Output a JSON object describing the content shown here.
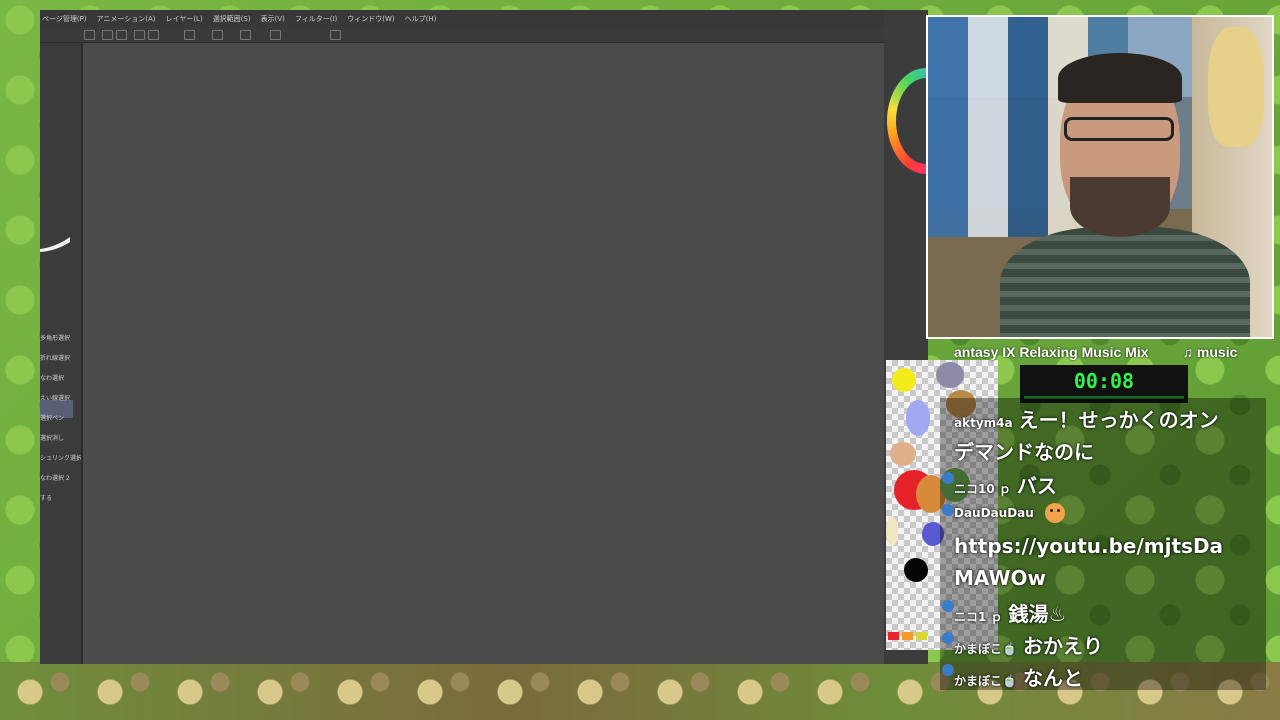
{
  "app": {
    "menu": [
      "ページ管理(P)",
      "アニメーション(A)",
      "レイヤー(L)",
      "選択範囲(S)",
      "表示(V)",
      "フィルター(I)",
      "ウィンドウ(W)",
      "ヘルプ(H)"
    ],
    "left_panel_items": [
      "多角形選択",
      "折れ線選択",
      "なわ選択",
      "えい線選択",
      "選択ペン",
      "選択消し",
      "シュリンク選択",
      "なわ選択 2",
      "する"
    ]
  },
  "stream": {
    "ticker": "antasy IX Relaxing Music Mix",
    "ticker_suffix": "♫ music",
    "timer": "00:08"
  },
  "chat": {
    "messages": [
      {
        "user": "aktym4a",
        "text": "えー！せっかくのオン"
      },
      {
        "user": "",
        "text": "デマンドなのに"
      },
      {
        "user": "ニコ10 ｐ",
        "text": "バス"
      },
      {
        "user": "DauDauDau",
        "text": ""
      },
      {
        "user": "",
        "text": "https://youtu.be/mjtsDa"
      },
      {
        "user": "",
        "text": "MAWOw"
      },
      {
        "user": "ニコ1 ｐ",
        "text": "銭湯♨"
      },
      {
        "user": "かまぼこ🍵",
        "text": "おかえり"
      },
      {
        "user": "かまぼこ🍵",
        "text": "なんと"
      }
    ]
  },
  "colors": {
    "timer_green": "#34f04a",
    "canvas_gray": "#4b4b4b",
    "background_green": "#6fae3c"
  }
}
